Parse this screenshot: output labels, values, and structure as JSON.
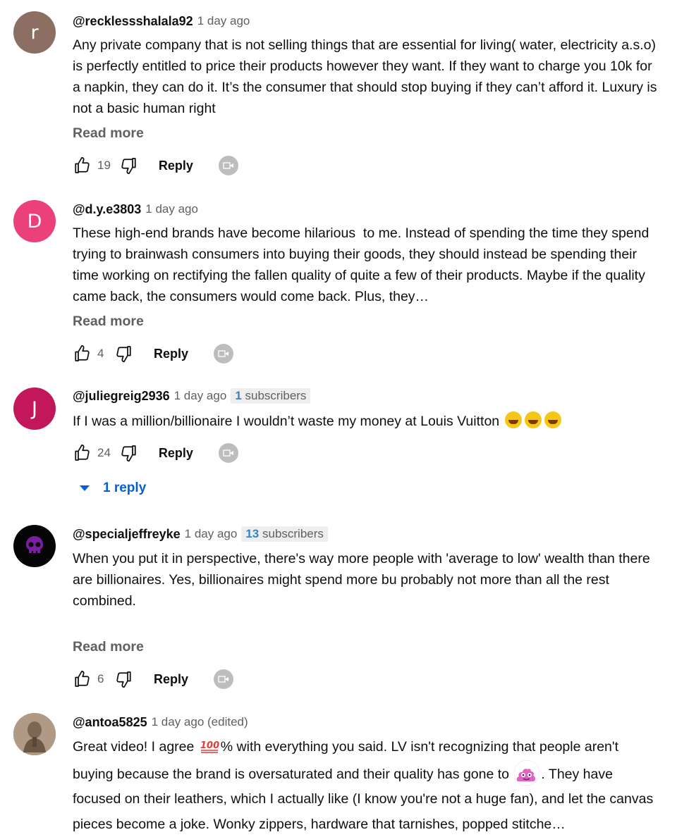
{
  "comments": [
    {
      "avatar_letter": "r",
      "avatar_color": "#8d6e63",
      "author": "@recklessshalala92",
      "time": "1 day ago",
      "text": "Any private company that is not selling things that are essential for living( water, electricity a.s.o) is perfectly entitled to price their products however they want. If they want to charge you 10k for a napkin, they can do it. It’s the consumer that should stop buying if they can’t afford it. Luxury is not a basic human right",
      "read_more": "Read more",
      "likes": "19",
      "reply_label": "Reply"
    },
    {
      "avatar_letter": "D",
      "avatar_color": "#ec407a",
      "author": "@d.y.e3803",
      "time": "1 day ago",
      "text": "These high-end brands have become hilarious  to me. Instead of spending the time they spend trying to brainwash consumers into buying their goods, they should instead be spending their time working on rectifying the fallen quality of quite a few of their products. Maybe if the quality came back, the consumers would come back. Plus, they…",
      "read_more": "Read more",
      "likes": "4",
      "reply_label": "Reply"
    },
    {
      "avatar_letter": "J",
      "avatar_color": "#c2185b",
      "author": "@juliegreig2936",
      "time": "1 day ago",
      "subs_count": "1",
      "subs_label": "subscribers",
      "text": "If I was a million/billionaire I wouldn’t waste my money at Louis Vuitton",
      "likes": "24",
      "reply_label": "Reply",
      "replies_toggle": "1 reply"
    },
    {
      "author": "@specialjeffreyke",
      "time": "1 day ago",
      "subs_count": "13",
      "subs_label": "subscribers",
      "text": "When you put it in perspective, there's way more people with 'average to low' wealth than there are billionaires. Yes, billionaires might spend more bu probably not more than all the rest combined.\n\n…",
      "read_more": "Read more",
      "likes": "6",
      "reply_label": "Reply"
    },
    {
      "author": "@antoa5825",
      "time": "1 day ago (edited)",
      "text_parts": [
        "Great video! I agree ",
        "% with everything you said. LV isn't recognizing that people aren't buying because the brand is oversaturated and their quality has gone to ",
        ". They have focused on their leathers, which I actually like (I know you're not a huge fan), and let the canvas pieces become a joke. Wonky zippers, hardware that tarnishes, popped stitche…"
      ]
    }
  ]
}
